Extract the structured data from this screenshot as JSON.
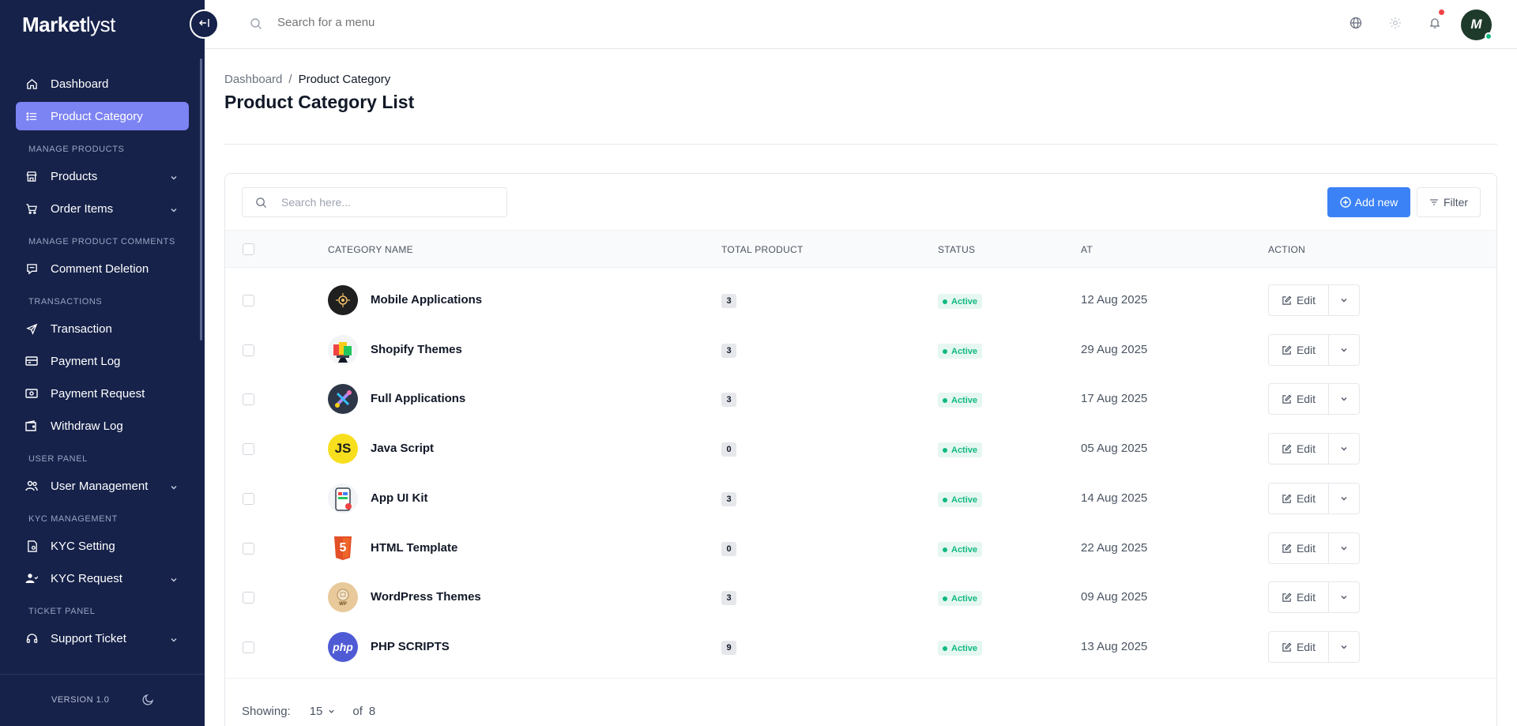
{
  "brand": {
    "name_bold": "Market",
    "name_thin": "lyst"
  },
  "sidebar": {
    "items": [
      {
        "label": "Dashboard"
      },
      {
        "label": "Product Category"
      }
    ],
    "sections": [
      {
        "heading": "MANAGE PRODUCTS",
        "items": [
          {
            "label": "Products"
          },
          {
            "label": "Order Items"
          }
        ]
      },
      {
        "heading": "MANAGE PRODUCT COMMENTS",
        "items": [
          {
            "label": "Comment Deletion"
          }
        ]
      },
      {
        "heading": "TRANSACTIONS",
        "items": [
          {
            "label": "Transaction"
          },
          {
            "label": "Payment Log"
          },
          {
            "label": "Payment Request"
          },
          {
            "label": "Withdraw Log"
          }
        ]
      },
      {
        "heading": "USER PANEL",
        "items": [
          {
            "label": "User Management"
          }
        ]
      },
      {
        "heading": "KYC MANAGEMENT",
        "items": [
          {
            "label": "KYC Setting"
          },
          {
            "label": "KYC Request"
          }
        ]
      },
      {
        "heading": "TICKET PANEL",
        "items": [
          {
            "label": "Support Ticket"
          }
        ]
      }
    ],
    "version": "VERSION 1.0"
  },
  "topbar": {
    "search_placeholder": "Search for a menu",
    "avatar_initial": "M"
  },
  "page": {
    "breadcrumb": {
      "root": "Dashboard",
      "separator": "/",
      "current": "Product Category"
    },
    "title": "Product Category List"
  },
  "toolbar": {
    "search_placeholder": "Search here...",
    "add_label": "Add new",
    "filter_label": "Filter"
  },
  "table": {
    "headers": {
      "name": "CATEGORY NAME",
      "total": "TOTAL PRODUCT",
      "status": "STATUS",
      "at": "AT",
      "action": "ACTION"
    },
    "edit_label": "Edit",
    "rows": [
      {
        "name": "Mobile Applications",
        "total": "3",
        "status": "Active",
        "date": "12 Aug 2025",
        "icon": "mobile-apps-icon"
      },
      {
        "name": "Shopify Themes",
        "total": "3",
        "status": "Active",
        "date": "29 Aug 2025",
        "icon": "shopify-icon"
      },
      {
        "name": "Full Applications",
        "total": "3",
        "status": "Active",
        "date": "17 Aug 2025",
        "icon": "full-apps-icon"
      },
      {
        "name": "Java Script",
        "total": "0",
        "status": "Active",
        "date": "05 Aug 2025",
        "icon": "javascript-icon",
        "icon_text": "JS"
      },
      {
        "name": "App UI Kit",
        "total": "3",
        "status": "Active",
        "date": "14 Aug 2025",
        "icon": "app-ui-kit-icon"
      },
      {
        "name": "HTML Template",
        "total": "0",
        "status": "Active",
        "date": "22 Aug 2025",
        "icon": "html5-icon",
        "icon_text": "5"
      },
      {
        "name": "WordPress Themes",
        "total": "3",
        "status": "Active",
        "date": "09 Aug 2025",
        "icon": "wordpress-icon",
        "icon_text": "WP"
      },
      {
        "name": "PHP SCRIPTS",
        "total": "9",
        "status": "Active",
        "date": "13 Aug 2025",
        "icon": "php-icon",
        "icon_text": "php"
      }
    ]
  },
  "pagination": {
    "showing_label": "Showing:",
    "per_page": "15",
    "of_label": "of",
    "total": "8"
  },
  "colors": {
    "sidebar_bg": "#16224a",
    "active_nav": "#7c83f3",
    "primary": "#3b82f6",
    "success": "#10b981",
    "danger": "#ef4444"
  }
}
